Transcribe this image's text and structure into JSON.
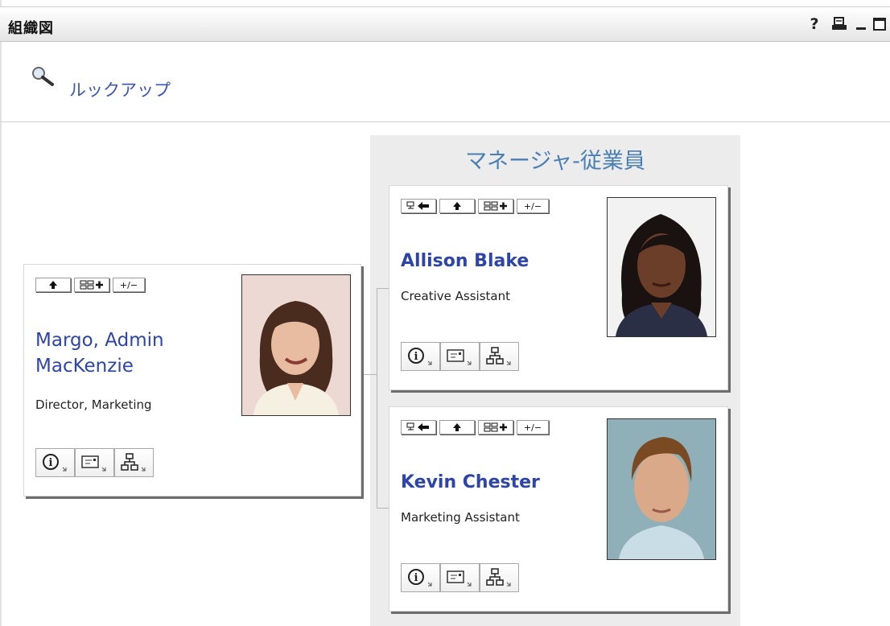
{
  "portlet": {
    "title": "組織図",
    "help_glyph": "?",
    "print_icon": "printer-icon",
    "minimize_icon": "minimize-icon",
    "maximize_icon": "maximize-icon"
  },
  "lookup": {
    "label": "ルックアップ",
    "icon": "magnifier-icon"
  },
  "panel": {
    "title": "マネージャ-従業員"
  },
  "manager": {
    "name_line1": "Margo, Admin",
    "name_line2": "MacKenzie",
    "role": "Director, Marketing",
    "top_buttons": [
      "up-arrow-icon",
      "expand-org-icon",
      "plus-minus"
    ],
    "plus_minus_label": "+/−",
    "actions": [
      "info-icon",
      "email-icon",
      "org-chart-icon"
    ]
  },
  "employees": [
    {
      "name": "Allison Blake",
      "role": "Creative Assistant",
      "top_buttons": [
        "set-root-icon",
        "up-arrow-icon",
        "expand-org-icon",
        "plus-minus"
      ],
      "plus_minus_label": "+/−",
      "actions": [
        "info-icon",
        "email-icon",
        "org-chart-icon"
      ]
    },
    {
      "name": "Kevin Chester",
      "role": "Marketing Assistant",
      "top_buttons": [
        "set-root-icon",
        "up-arrow-icon",
        "expand-org-icon",
        "plus-minus"
      ],
      "plus_minus_label": "+/−",
      "actions": [
        "info-icon",
        "email-icon",
        "org-chart-icon"
      ]
    }
  ],
  "colors": {
    "link_blue": "#2d44a8",
    "panel_title_blue": "#4a7fb5",
    "panel_bg": "#ececec"
  }
}
